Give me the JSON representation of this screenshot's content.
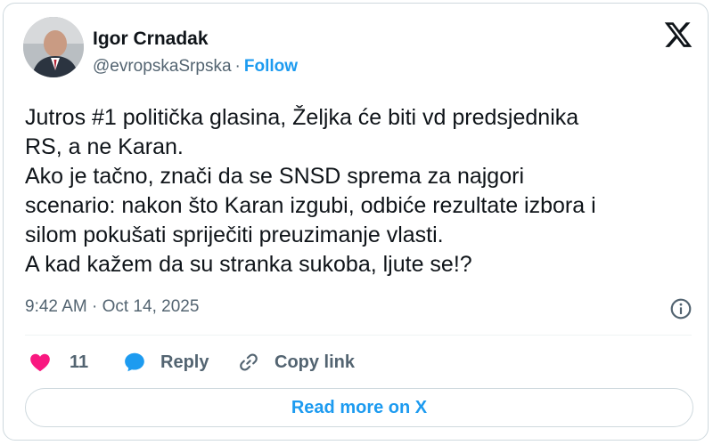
{
  "author": {
    "name": "Igor Crnadak",
    "handle": "@evropskaSrpska",
    "separator": "·",
    "follow_label": "Follow"
  },
  "logo_icon": "x-logo-icon",
  "tweet": {
    "text": "Jutros #1 politička glasina, Željka će biti vd predsjednika\nRS, a ne Karan.\nAko je tačno, znači da se SNSD sprema za najgori\nscenario: nakon što Karan izgubi, odbiće rezultate izbora i\nsilom pokušati spriječiti preuzimanje vlasti.\nA kad kažem da su stranka sukoba, ljute se!?",
    "timestamp": "9:42 AM · Oct 14, 2025"
  },
  "actions": {
    "like_count": "11",
    "reply_label": "Reply",
    "copy_link_label": "Copy link"
  },
  "read_more_label": "Read more on X",
  "colors": {
    "accent": "#1d9bf0",
    "like": "#f91880",
    "text": "#0f1419",
    "secondary": "#536471",
    "border": "#cfd9de"
  }
}
